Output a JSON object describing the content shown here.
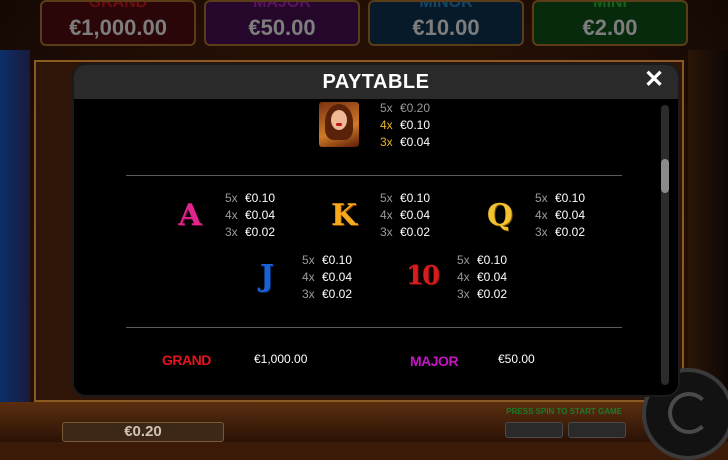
{
  "background": {
    "jackpots": [
      {
        "name": "GRAND",
        "amount": "€1,000.00"
      },
      {
        "name": "MAJOR",
        "amount": "€50.00"
      },
      {
        "name": "MINOR",
        "amount": "€10.00"
      },
      {
        "name": "MINI",
        "amount": "€2.00"
      }
    ],
    "bet_display": "€0.20",
    "start_hint": "PRESS SPIN TO START GAME"
  },
  "modal": {
    "title": "PAYTABLE",
    "close_icon": "close-icon",
    "colors": {
      "highlight": "#e6b422",
      "grand": "#e3141d",
      "major": "#c414c4"
    },
    "top_symbol": {
      "icon": "woman-portrait-icon",
      "pays": [
        {
          "mult": "5x",
          "value": "€0.20"
        },
        {
          "mult": "4x",
          "value": "€0.10"
        },
        {
          "mult": "3x",
          "value": "€0.04"
        }
      ]
    },
    "card_symbols": [
      {
        "symbol": "A",
        "pays": [
          {
            "mult": "5x",
            "value": "€0.10"
          },
          {
            "mult": "4x",
            "value": "€0.04"
          },
          {
            "mult": "3x",
            "value": "€0.02"
          }
        ]
      },
      {
        "symbol": "K",
        "pays": [
          {
            "mult": "5x",
            "value": "€0.10"
          },
          {
            "mult": "4x",
            "value": "€0.04"
          },
          {
            "mult": "3x",
            "value": "€0.02"
          }
        ]
      },
      {
        "symbol": "Q",
        "pays": [
          {
            "mult": "5x",
            "value": "€0.10"
          },
          {
            "mult": "4x",
            "value": "€0.04"
          },
          {
            "mult": "3x",
            "value": "€0.02"
          }
        ]
      },
      {
        "symbol": "J",
        "pays": [
          {
            "mult": "5x",
            "value": "€0.10"
          },
          {
            "mult": "4x",
            "value": "€0.04"
          },
          {
            "mult": "3x",
            "value": "€0.02"
          }
        ]
      },
      {
        "symbol": "10",
        "pays": [
          {
            "mult": "5x",
            "value": "€0.10"
          },
          {
            "mult": "4x",
            "value": "€0.04"
          },
          {
            "mult": "3x",
            "value": "€0.02"
          }
        ]
      }
    ],
    "jackpot_rows": [
      {
        "label": "GRAND",
        "value": "€1,000.00"
      },
      {
        "label": "MAJOR",
        "value": "€50.00"
      }
    ]
  }
}
